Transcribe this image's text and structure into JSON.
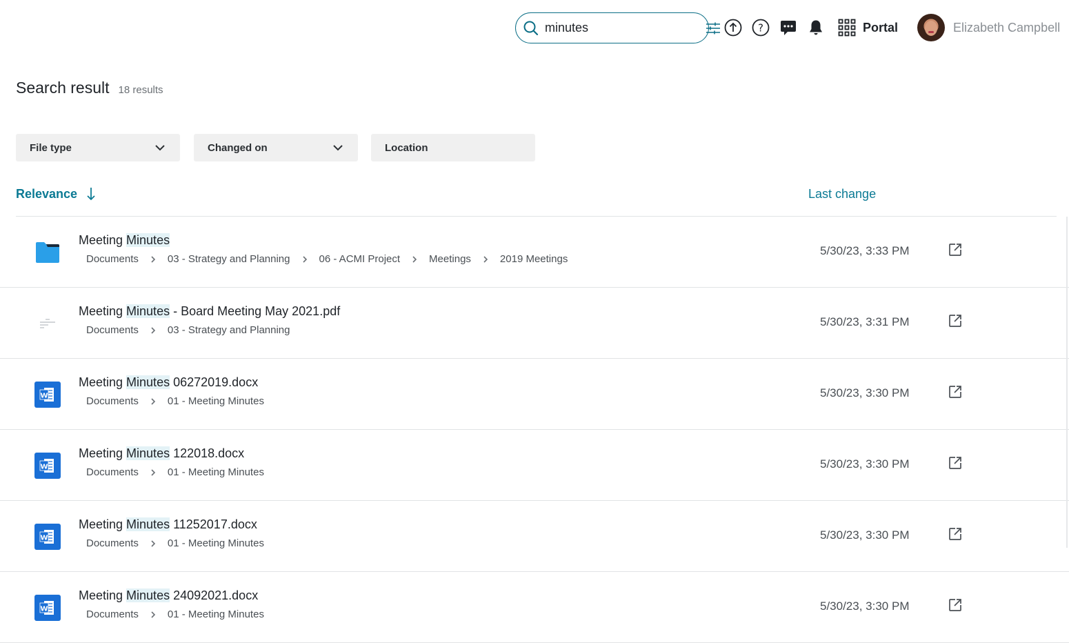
{
  "search": {
    "value": "minutes",
    "icon": "search-icon",
    "filter_icon": "sliders-icon",
    "border_color": "#0b6e86"
  },
  "header": {
    "icons": [
      "upload-icon",
      "help-icon",
      "chat-icon",
      "bell-icon"
    ],
    "portal_label": "Portal",
    "user_name": "Elizabeth Campbell"
  },
  "results_header": {
    "title": "Search result",
    "count": "18 results"
  },
  "filters": [
    {
      "label": "File type",
      "has_dropdown": true
    },
    {
      "label": "Changed on",
      "has_dropdown": true
    },
    {
      "label": "Location",
      "has_dropdown": false
    }
  ],
  "sort": {
    "label": "Relevance",
    "direction": "descending",
    "last_change_label": "Last change",
    "accent_color": "#0b7a94"
  },
  "results": [
    {
      "type": "folder",
      "name_prefix": "Meeting ",
      "name_highlight": "Minutes",
      "name_suffix": "",
      "path": [
        "Documents",
        "03 - Strategy and Planning",
        "06 - ACMI Project",
        "Meetings",
        "2019 Meetings"
      ],
      "date": "5/30/23, 3:33 PM"
    },
    {
      "type": "pdf",
      "name_prefix": "Meeting ",
      "name_highlight": "Minutes",
      "name_suffix": " - Board Meeting May 2021.pdf",
      "path": [
        "Documents",
        "03 - Strategy and Planning"
      ],
      "date": "5/30/23, 3:31 PM"
    },
    {
      "type": "word",
      "name_prefix": "Meeting ",
      "name_highlight": "Minutes",
      "name_suffix": " 06272019.docx",
      "path": [
        "Documents",
        "01 - Meeting Minutes"
      ],
      "date": "5/30/23, 3:30 PM"
    },
    {
      "type": "word",
      "name_prefix": "Meeting ",
      "name_highlight": "Minutes",
      "name_suffix": " 122018.docx",
      "path": [
        "Documents",
        "01 - Meeting Minutes"
      ],
      "date": "5/30/23, 3:30 PM"
    },
    {
      "type": "word",
      "name_prefix": "Meeting ",
      "name_highlight": "Minutes",
      "name_suffix": " 11252017.docx",
      "path": [
        "Documents",
        "01 - Meeting Minutes"
      ],
      "date": "5/30/23, 3:30 PM"
    },
    {
      "type": "word",
      "name_prefix": "Meeting ",
      "name_highlight": "Minutes",
      "name_suffix": " 24092021.docx",
      "path": [
        "Documents",
        "01 - Meeting Minutes"
      ],
      "date": "5/30/23, 3:30 PM"
    }
  ]
}
